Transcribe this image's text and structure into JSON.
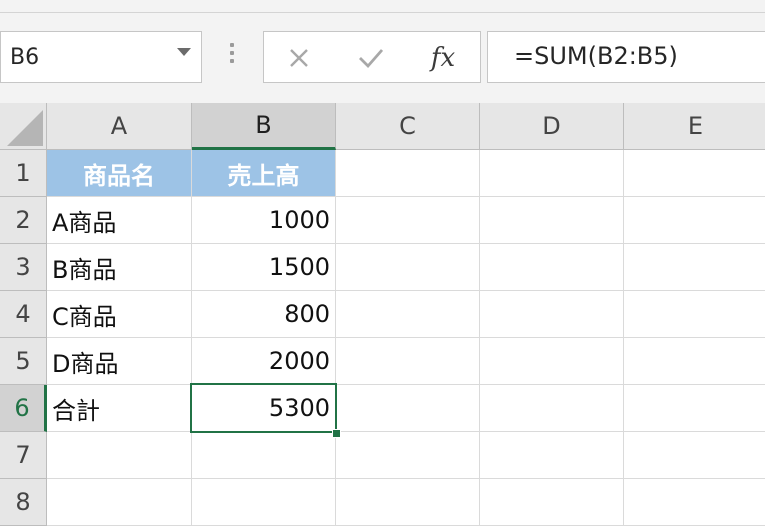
{
  "formula_bar": {
    "name_box": "B6",
    "cancel_icon": "close-icon",
    "enter_icon": "check-icon",
    "fx_label": "fx",
    "formula": "=SUM(B2:B5)"
  },
  "columns": [
    "A",
    "B",
    "C",
    "D",
    "E"
  ],
  "rows": [
    "1",
    "2",
    "3",
    "4",
    "5",
    "6",
    "7",
    "8"
  ],
  "cells": {
    "A1": "商品名",
    "B1": "売上高",
    "A2": "A商品",
    "B2": "1000",
    "A3": "B商品",
    "B3": "1500",
    "A4": "C商品",
    "B4": "800",
    "A5": "D商品",
    "B5": "2000",
    "A6": "合計",
    "B6": "5300"
  },
  "active_cell": "B6",
  "colors": {
    "header_fill": "#9dc3e6",
    "accent": "#217346"
  }
}
